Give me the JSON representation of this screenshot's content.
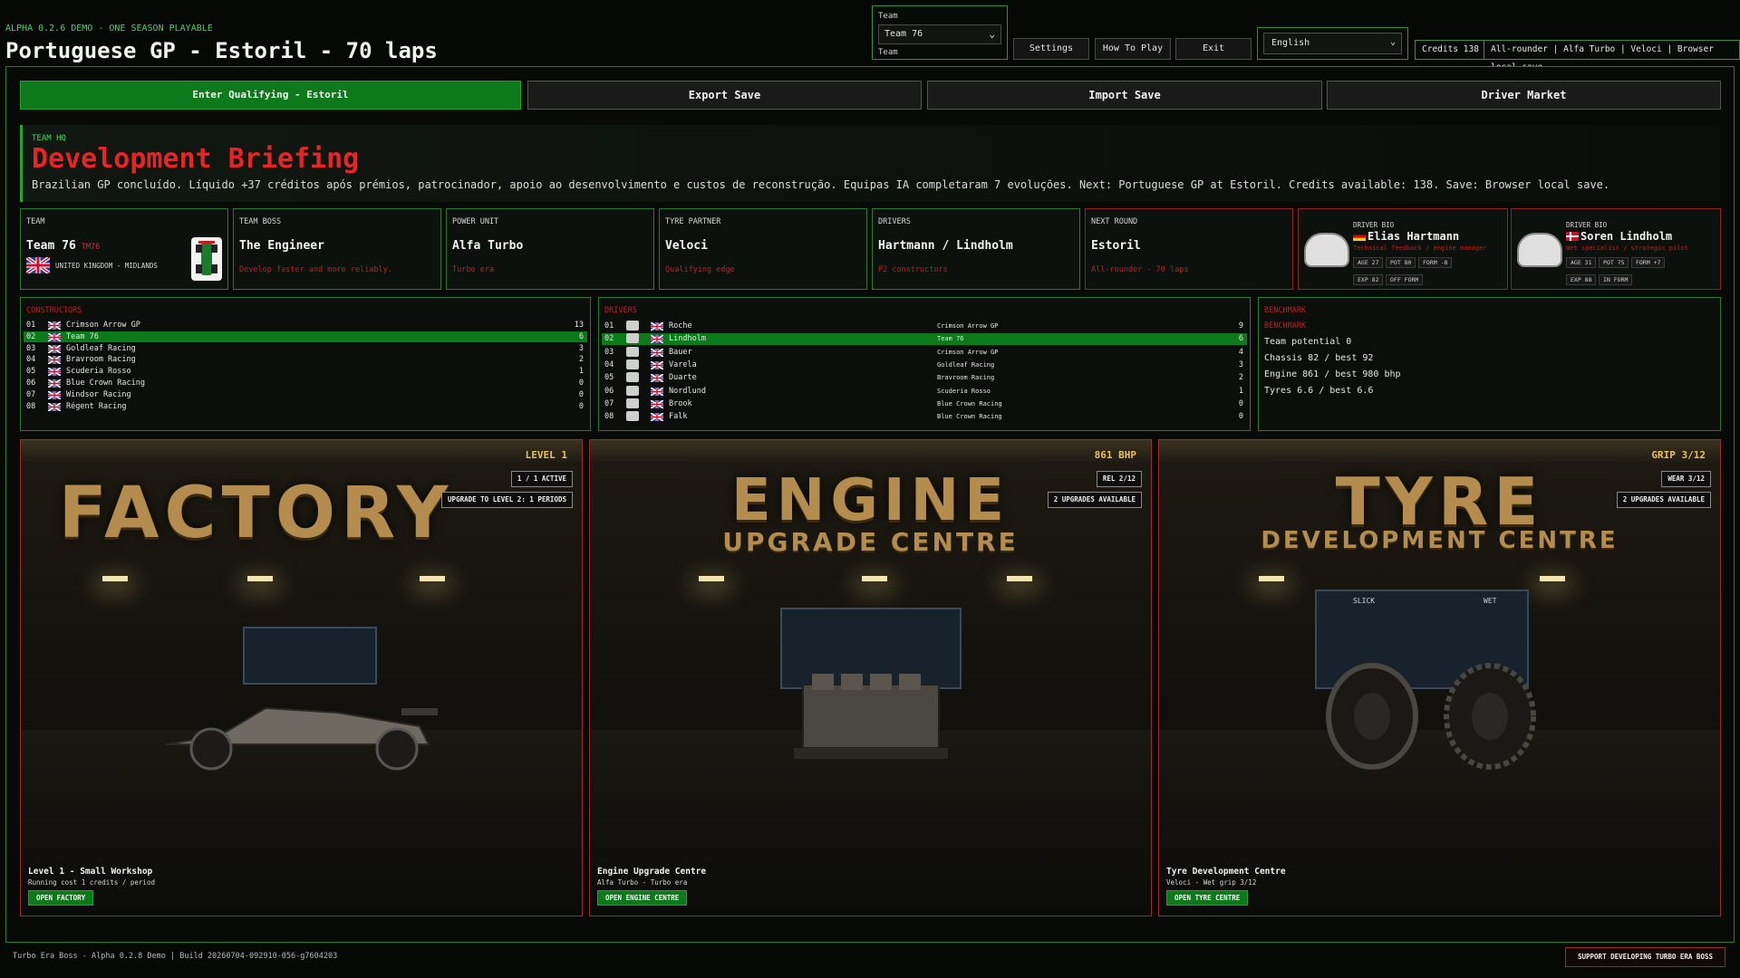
{
  "header": {
    "demo_tag": "ALPHA 0.2.6 DEMO - ONE SEASON PLAYABLE",
    "title": "Portuguese GP - Estoril - 70 laps"
  },
  "team_selector": {
    "label_top": "Team",
    "value": "Team 76",
    "label_bottom": "Team"
  },
  "toolbar": {
    "settings": "Settings",
    "how_to_play": "How To Play",
    "exit": "Exit",
    "language": "English",
    "credits": "Credits 138",
    "summary": "All-rounder | Alfa Turbo | Veloci | Browser local save"
  },
  "actions": {
    "qualify": "Enter Qualifying - Estoril",
    "export": "Export Save",
    "import": "Import Save",
    "market": "Driver Market"
  },
  "briefing": {
    "tag": "TEAM HQ",
    "title": "Development Briefing",
    "text": "Brazilian GP concluído. Líquido +37 créditos após prémios, patrocinador, apoio ao desenvolvimento e custos de reconstrução. Equipas IA completaram 7 evoluções. Next: Portuguese GP at Estoril. Credits available: 138. Save: Browser local save."
  },
  "cards": {
    "team": {
      "key": "TEAM",
      "value": "Team 76",
      "tag": "TM76",
      "origin": "UNITED KINGDOM - MIDLANDS"
    },
    "boss": {
      "key": "TEAM BOSS",
      "value": "The Engineer",
      "sub": "Develop faster and more reliably."
    },
    "power": {
      "key": "POWER UNIT",
      "value": "Alfa Turbo",
      "sub": "Turbo era"
    },
    "tyre": {
      "key": "TYRE PARTNER",
      "value": "Veloci",
      "sub": "Qualifying edge"
    },
    "drivers": {
      "key": "DRIVERS",
      "value": "Hartmann / Lindholm",
      "sub": "P2 constructors"
    },
    "next": {
      "key": "NEXT ROUND",
      "value": "Estoril",
      "sub": "All-rounder - 70 laps"
    }
  },
  "bios": [
    {
      "key": "DRIVER BIO",
      "name": "Elias Hartmann",
      "note": "Technical feedback / engine manager",
      "chips": [
        "AGE 27",
        "POT 80",
        "FORM -8",
        "EXP 82",
        "OFF FORM"
      ]
    },
    {
      "key": "DRIVER BIO",
      "name": "Soren Lindholm",
      "note": "Wet specialist / strategic pilot",
      "chips": [
        "AGE 31",
        "POT 75",
        "FORM +7",
        "EXP 88",
        "IN FORM"
      ]
    }
  ],
  "constructors": {
    "header": "CONSTRUCTORS",
    "rows": [
      {
        "pos": "01",
        "name": "Crimson Arrow GP",
        "pts": "13"
      },
      {
        "pos": "02",
        "name": "Team 76",
        "pts": "6"
      },
      {
        "pos": "03",
        "name": "Goldleaf Racing",
        "pts": "3"
      },
      {
        "pos": "04",
        "name": "Bravroom Racing",
        "pts": "2"
      },
      {
        "pos": "05",
        "name": "Scuderia Rosso",
        "pts": "1"
      },
      {
        "pos": "06",
        "name": "Blue Crown Racing",
        "pts": "0"
      },
      {
        "pos": "07",
        "name": "Windsor Racing",
        "pts": "0"
      },
      {
        "pos": "08",
        "name": "Régent Racing",
        "pts": "0"
      }
    ]
  },
  "drivers_table": {
    "header": "DRIVERS",
    "rows": [
      {
        "pos": "01",
        "name": "Roche",
        "team": "Crimson Arrow GP",
        "pts": "9"
      },
      {
        "pos": "02",
        "name": "Lindholm",
        "team": "Team 76",
        "pts": "6"
      },
      {
        "pos": "03",
        "name": "Bauer",
        "team": "Crimson Arrow GP",
        "pts": "4"
      },
      {
        "pos": "04",
        "name": "Varela",
        "team": "Goldleaf Racing",
        "pts": "3"
      },
      {
        "pos": "05",
        "name": "Duarte",
        "team": "Bravroom Racing",
        "pts": "2"
      },
      {
        "pos": "06",
        "name": "Nordlund",
        "team": "Scuderia Rosso",
        "pts": "1"
      },
      {
        "pos": "07",
        "name": "Brook",
        "team": "Blue Crown Racing",
        "pts": "0"
      },
      {
        "pos": "08",
        "name": "Falk",
        "team": "Blue Crown Racing",
        "pts": "0"
      }
    ]
  },
  "benchmark": {
    "header1": "BENCHMARK",
    "header2": "BENCHMARK",
    "lines": [
      "Team potential 0",
      "Chassis 82 / best 92",
      "Engine 861 / best 980 bhp",
      "Tyres 6.6 / best 6.6"
    ]
  },
  "facilities": {
    "factory": {
      "header": "LEVEL 1",
      "title": "FACTORY",
      "subtitle": "",
      "badge1": "1 / 1 ACTIVE",
      "badge2": "UPGRADE TO LEVEL 2: 1 PERIODS",
      "caption": "Level 1 - Small Workshop",
      "caption2": "Running cost 1 credits / period",
      "button": "OPEN FACTORY"
    },
    "engine": {
      "header": "861 BHP",
      "title": "ENGINE",
      "subtitle": "UPGRADE CENTRE",
      "badge1": "REL 2/12",
      "badge2": "2 UPGRADES AVAILABLE",
      "caption": "Engine Upgrade Centre",
      "caption2": "Alfa Turbo - Turbo era",
      "button": "OPEN ENGINE CENTRE"
    },
    "tyre": {
      "header": "GRIP 3/12",
      "title": "TYRE",
      "subtitle": "DEVELOPMENT CENTRE",
      "badge1": "WEAR 3/12",
      "badge2": "2 UPGRADES AVAILABLE",
      "caption": "Tyre Development Centre",
      "caption2": "Veloci - Wet grip 3/12",
      "button": "OPEN TYRE CENTRE",
      "blueprint_labels": [
        "SLICK",
        "WET"
      ]
    }
  },
  "footer": {
    "build": "Turbo Era Boss - Alpha 0.2.8 Demo | Build 20260704-092910-056-g7604203",
    "support": "SUPPORT DEVELOPING TURBO ERA BOSS"
  },
  "colors": {
    "accent_green": "#0c7a1b",
    "alert_red": "#ea2424",
    "gold": "#b48d4e"
  }
}
